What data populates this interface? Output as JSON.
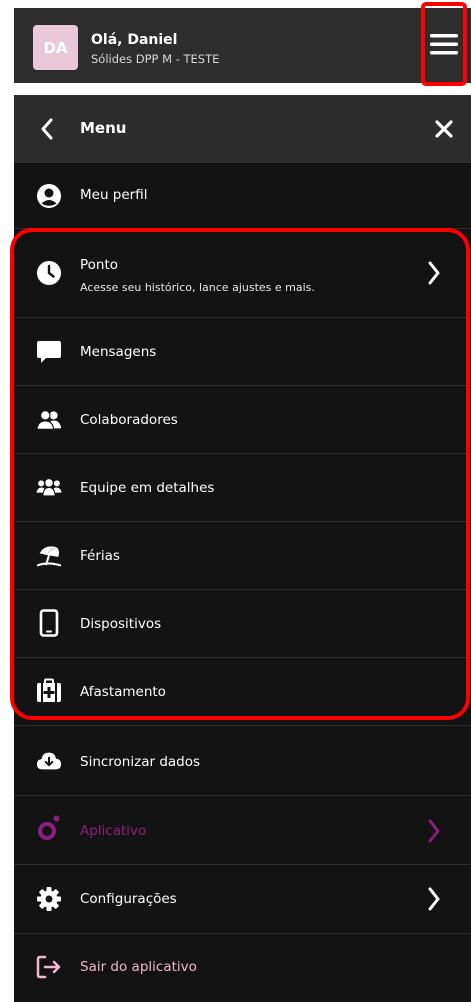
{
  "header": {
    "avatar_initials": "DA",
    "greeting": "Olá, Daniel",
    "company": "Sólides DPP M - TESTE",
    "menu_icon": "hamburger-icon"
  },
  "panel": {
    "title": "Menu",
    "back_icon": "chevron-left-icon",
    "close_icon": "close-icon"
  },
  "items": [
    {
      "label": "Meu perfil",
      "icon": "user-circle-icon"
    },
    {
      "label": "Ponto",
      "subtitle": "Acesse seu histórico, lance ajustes e mais.",
      "icon": "clock-icon",
      "chevron": true
    },
    {
      "label": "Mensagens",
      "icon": "chat-bubble-icon"
    },
    {
      "label": "Colaboradores",
      "icon": "users-icon"
    },
    {
      "label": "Equipe em detalhes",
      "icon": "team-icon"
    },
    {
      "label": "Férias",
      "icon": "beach-umbrella-icon"
    },
    {
      "label": "Dispositivos",
      "icon": "mobile-device-icon"
    },
    {
      "label": "Afastamento",
      "icon": "medical-kit-icon"
    },
    {
      "label": "Sincronizar dados",
      "icon": "cloud-download-icon"
    },
    {
      "label": "Aplicativo",
      "icon": "solides-logo-icon",
      "chevron": true
    },
    {
      "label": "Configurações",
      "icon": "gear-icon",
      "chevron": true
    },
    {
      "label": "Sair do aplicativo",
      "icon": "logout-icon"
    }
  ],
  "colors": {
    "panel_bg": "#131313",
    "header_bg": "#2d2d2d",
    "highlight": "#ff0000",
    "accent_purple": "#8a1f7e",
    "logout_pink": "#f2b6cf"
  }
}
